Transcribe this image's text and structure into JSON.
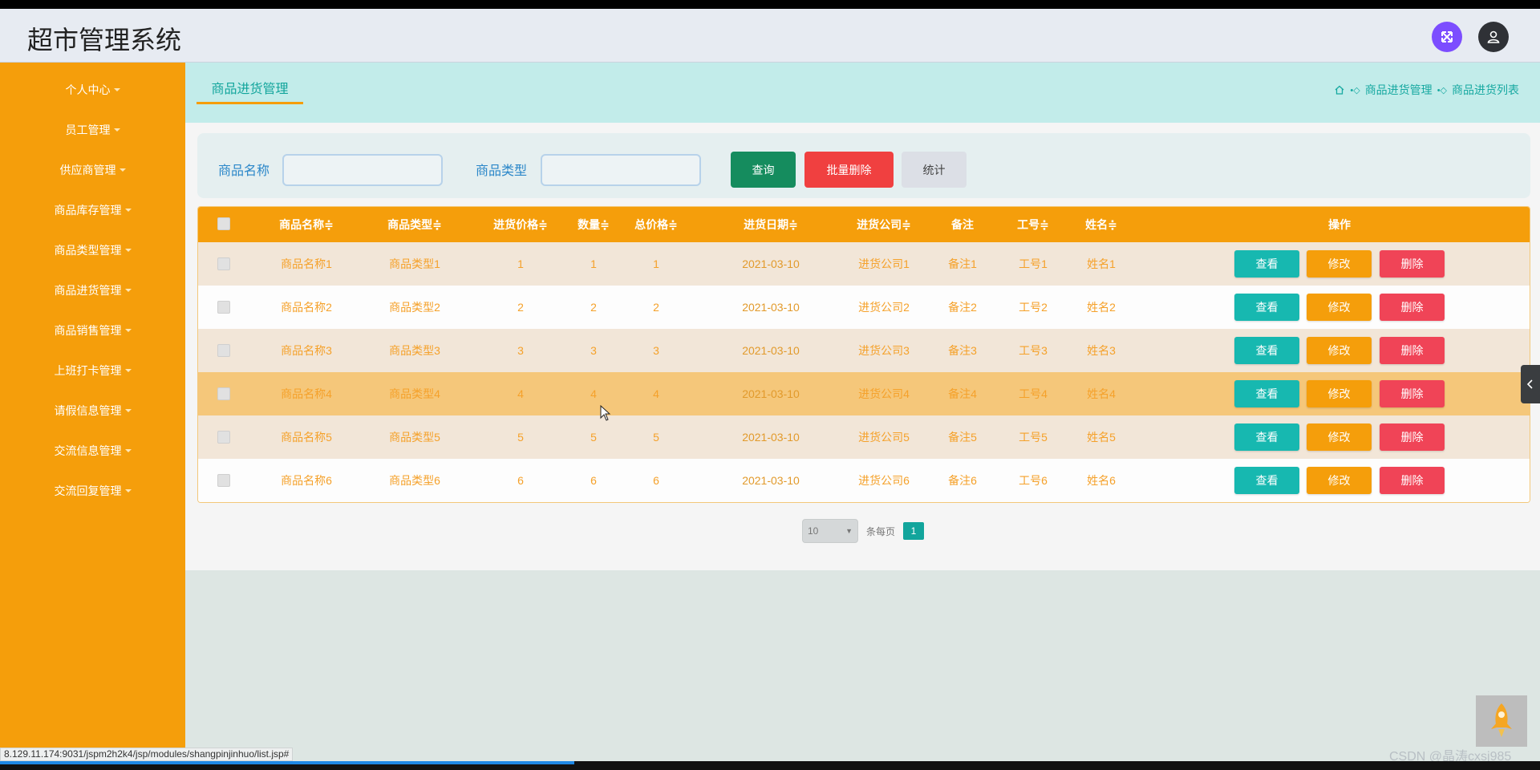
{
  "app": {
    "title": "超市管理系统"
  },
  "topbar": {
    "expand_icon": "expand-arrows-icon",
    "user_icon": "user-icon"
  },
  "sidebar": {
    "items": [
      {
        "label": "个人中心"
      },
      {
        "label": "员工管理"
      },
      {
        "label": "供应商管理"
      },
      {
        "label": "商品库存管理"
      },
      {
        "label": "商品类型管理"
      },
      {
        "label": "商品进货管理"
      },
      {
        "label": "商品销售管理"
      },
      {
        "label": "上班打卡管理"
      },
      {
        "label": "请假信息管理"
      },
      {
        "label": "交流信息管理"
      },
      {
        "label": "交流回复管理"
      }
    ]
  },
  "tabs": {
    "active": "商品进货管理"
  },
  "breadcrumb": {
    "items": [
      "商品进货管理",
      "商品进货列表"
    ]
  },
  "search": {
    "name_label": "商品名称",
    "name_value": "",
    "type_label": "商品类型",
    "type_value": "",
    "query_button": "查询",
    "batch_delete_button": "批量删除",
    "stats_button": "统计"
  },
  "table": {
    "headers": [
      "商品名称≑",
      "商品类型≑",
      "进货价格≑",
      "数量≑",
      "总价格≑",
      "进货日期≑",
      "进货公司≑",
      "备注",
      "工号≑",
      "姓名≑",
      "操作"
    ],
    "rows": [
      {
        "name": "商品名称1",
        "type": "商品类型1",
        "price": "1",
        "qty": "1",
        "total": "1",
        "date": "2021-03-10",
        "company": "进货公司1",
        "note": "备注1",
        "job_no": "工号1",
        "person": "姓名1"
      },
      {
        "name": "商品名称2",
        "type": "商品类型2",
        "price": "2",
        "qty": "2",
        "total": "2",
        "date": "2021-03-10",
        "company": "进货公司2",
        "note": "备注2",
        "job_no": "工号2",
        "person": "姓名2"
      },
      {
        "name": "商品名称3",
        "type": "商品类型3",
        "price": "3",
        "qty": "3",
        "total": "3",
        "date": "2021-03-10",
        "company": "进货公司3",
        "note": "备注3",
        "job_no": "工号3",
        "person": "姓名3"
      },
      {
        "name": "商品名称4",
        "type": "商品类型4",
        "price": "4",
        "qty": "4",
        "total": "4",
        "date": "2021-03-10",
        "company": "进货公司4",
        "note": "备注4",
        "job_no": "工号4",
        "person": "姓名4"
      },
      {
        "name": "商品名称5",
        "type": "商品类型5",
        "price": "5",
        "qty": "5",
        "total": "5",
        "date": "2021-03-10",
        "company": "进货公司5",
        "note": "备注5",
        "job_no": "工号5",
        "person": "姓名5"
      },
      {
        "name": "商品名称6",
        "type": "商品类型6",
        "price": "6",
        "qty": "6",
        "total": "6",
        "date": "2021-03-10",
        "company": "进货公司6",
        "note": "备注6",
        "job_no": "工号6",
        "person": "姓名6"
      }
    ],
    "actions": {
      "view": "查看",
      "edit": "修改",
      "delete": "删除"
    }
  },
  "pagination": {
    "page_size": "10",
    "per_page_label": "条每页",
    "current_page": "1"
  },
  "status_bar": {
    "url": "8.129.11.174:9031/jspm2h2k4/jsp/modules/shangpinjinhuo/list.jsp#"
  },
  "watermark": "CSDN @晶涛cxsj985",
  "colors": {
    "sidebar": "#f59e0b",
    "accent": "#12a59c",
    "danger": "#f04457",
    "query": "#158c5e"
  }
}
